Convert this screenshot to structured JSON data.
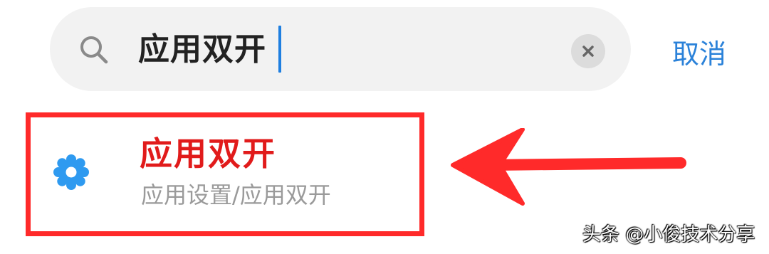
{
  "search": {
    "query": "应用双开",
    "icon": "search-icon",
    "clear_icon": "close-icon"
  },
  "cancel_label": "取消",
  "result": {
    "icon": "gear-icon",
    "title": "应用双开",
    "path": "应用设置/应用双开"
  },
  "annotation": {
    "highlight_color": "#ff2a2a",
    "arrow_color": "#ff2a2a"
  },
  "watermark": "头条 @小俊技术分享",
  "colors": {
    "accent": "#2b82d9",
    "caret": "#1f7fe0",
    "search_bg": "#f2f2f2",
    "title_red": "#e11b1b",
    "path_gray": "#9a9a9a"
  }
}
